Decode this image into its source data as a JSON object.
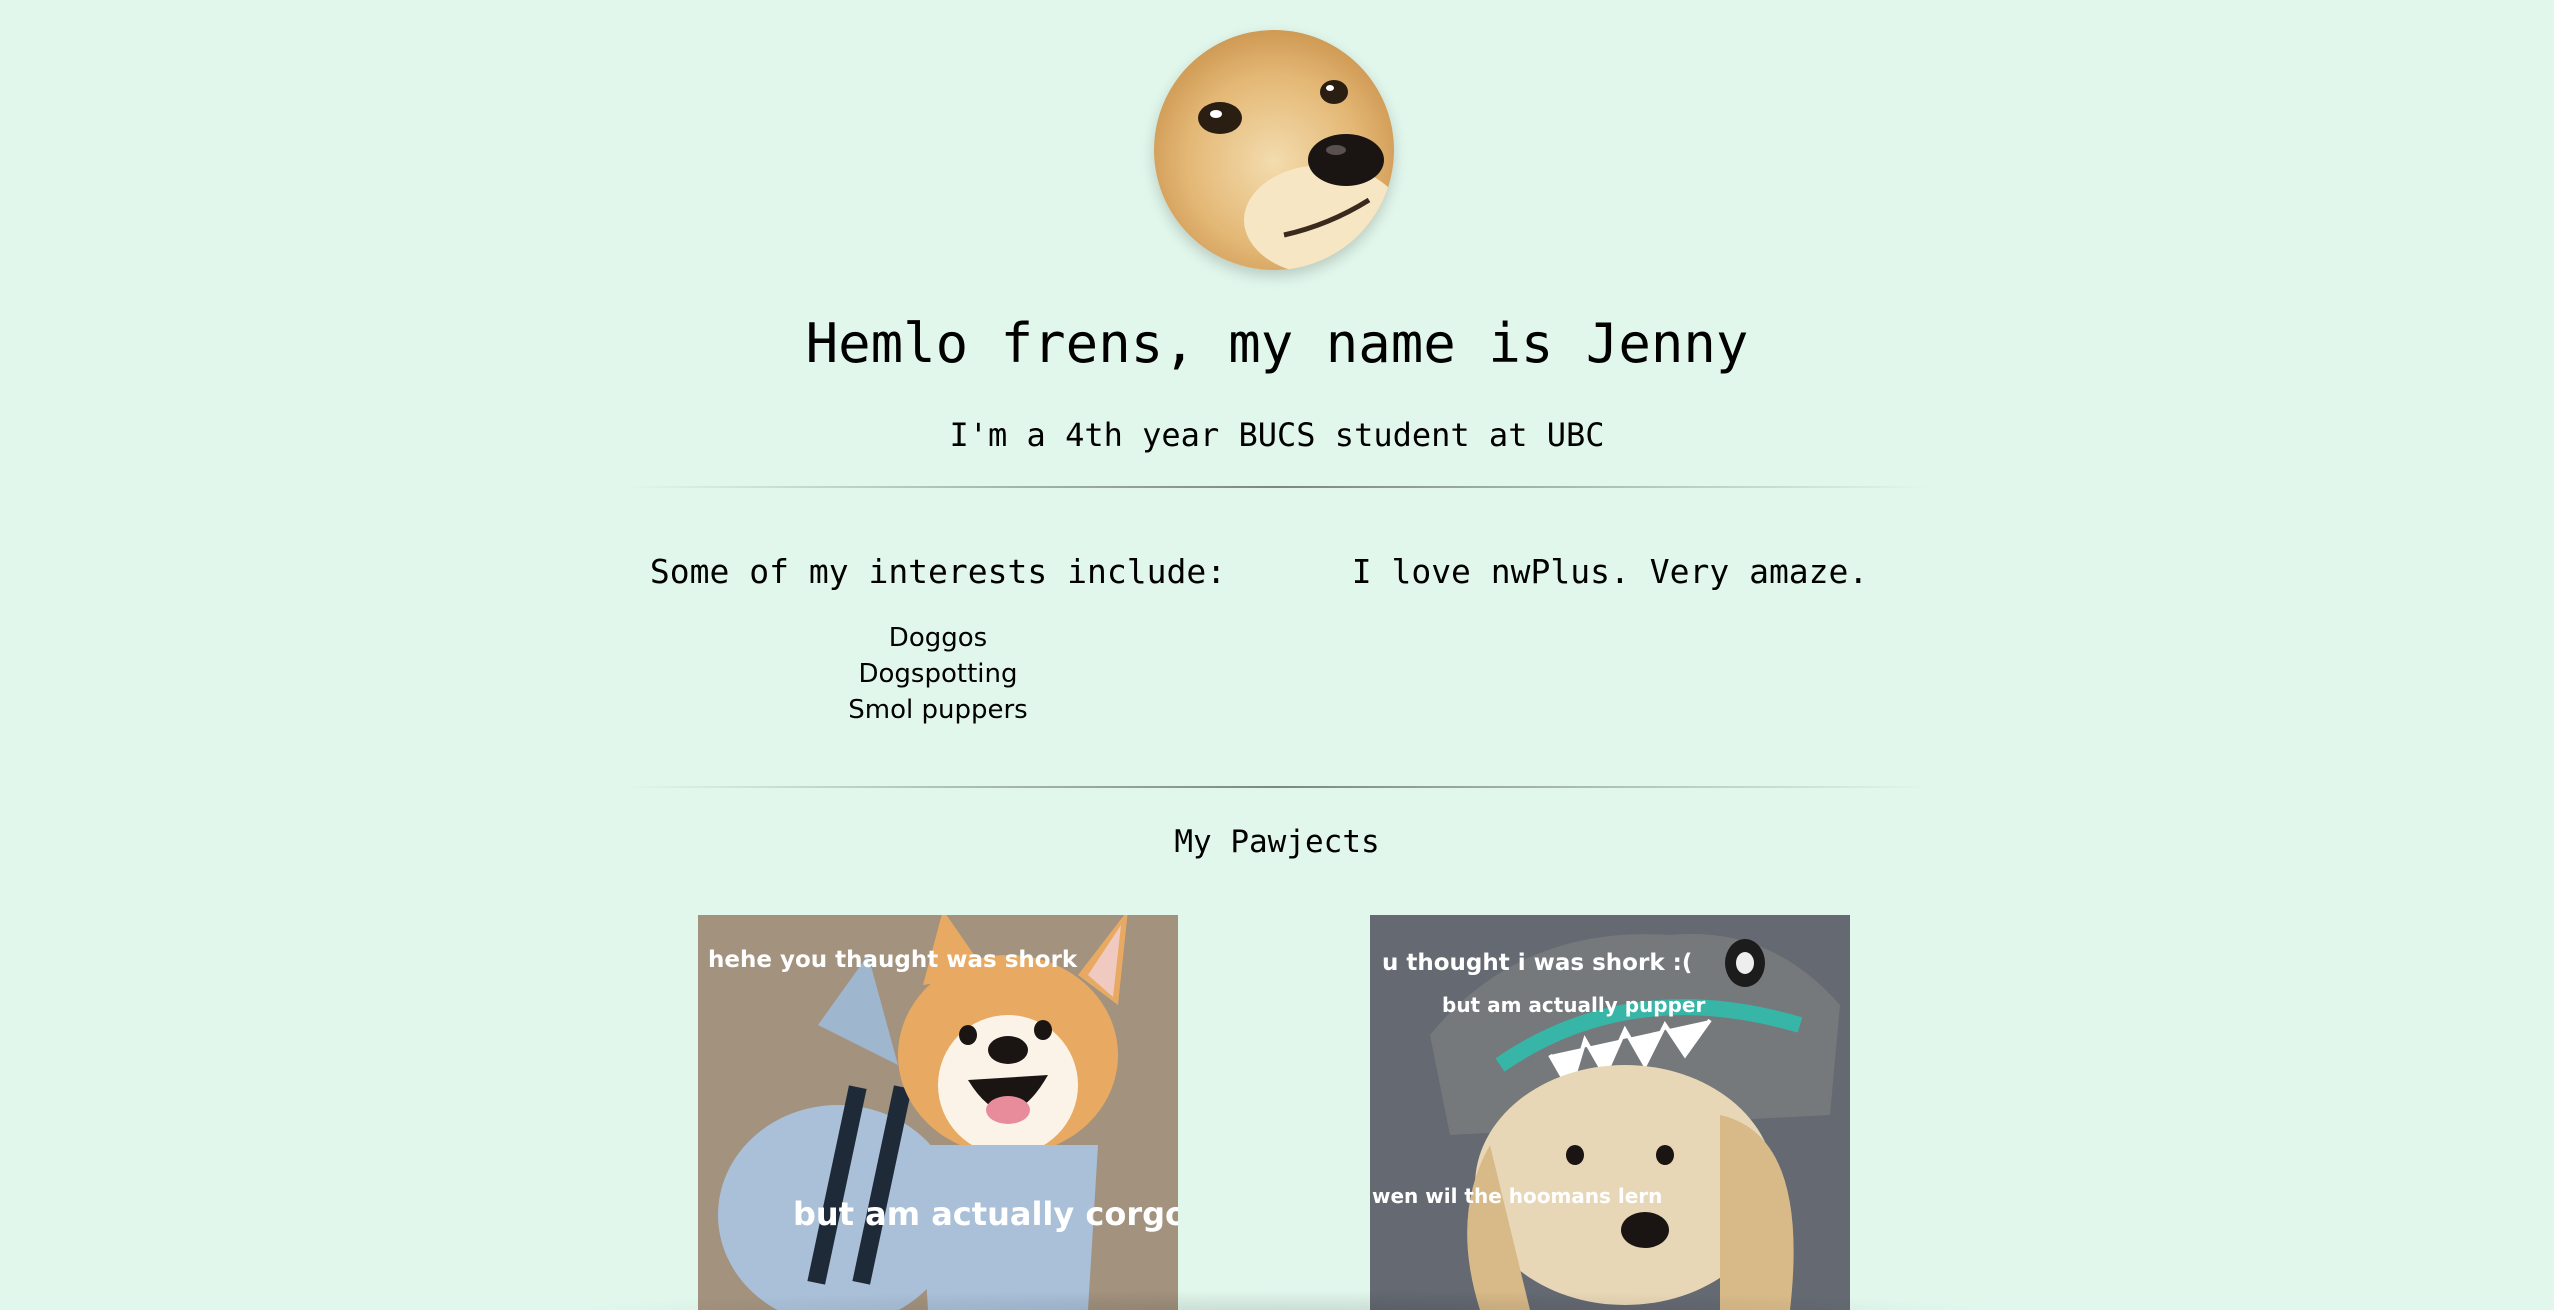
{
  "profile": {
    "avatar_alt": "doge face",
    "title": "Hemlo frens, my name is Jenny",
    "subtitle": "I'm a 4th year BUCS student at UBC"
  },
  "interests": {
    "heading": "Some of my interests include:",
    "items": [
      "Doggos",
      "Dogspotting",
      "Smol puppers"
    ]
  },
  "love": {
    "text": "I love nwPlus. Very amaze."
  },
  "projects": {
    "heading": "My Pawjects",
    "items": [
      {
        "caption_top": "hehe you thaught was shork",
        "caption_bottom": "but am actually corgo"
      },
      {
        "caption_top": "u thought i was shork :(",
        "caption_middle": "but am actually pupper",
        "caption_bottom": "wen wil the hoomans lern"
      }
    ]
  },
  "colors": {
    "background": "#e1f7ec",
    "text": "#000000"
  }
}
